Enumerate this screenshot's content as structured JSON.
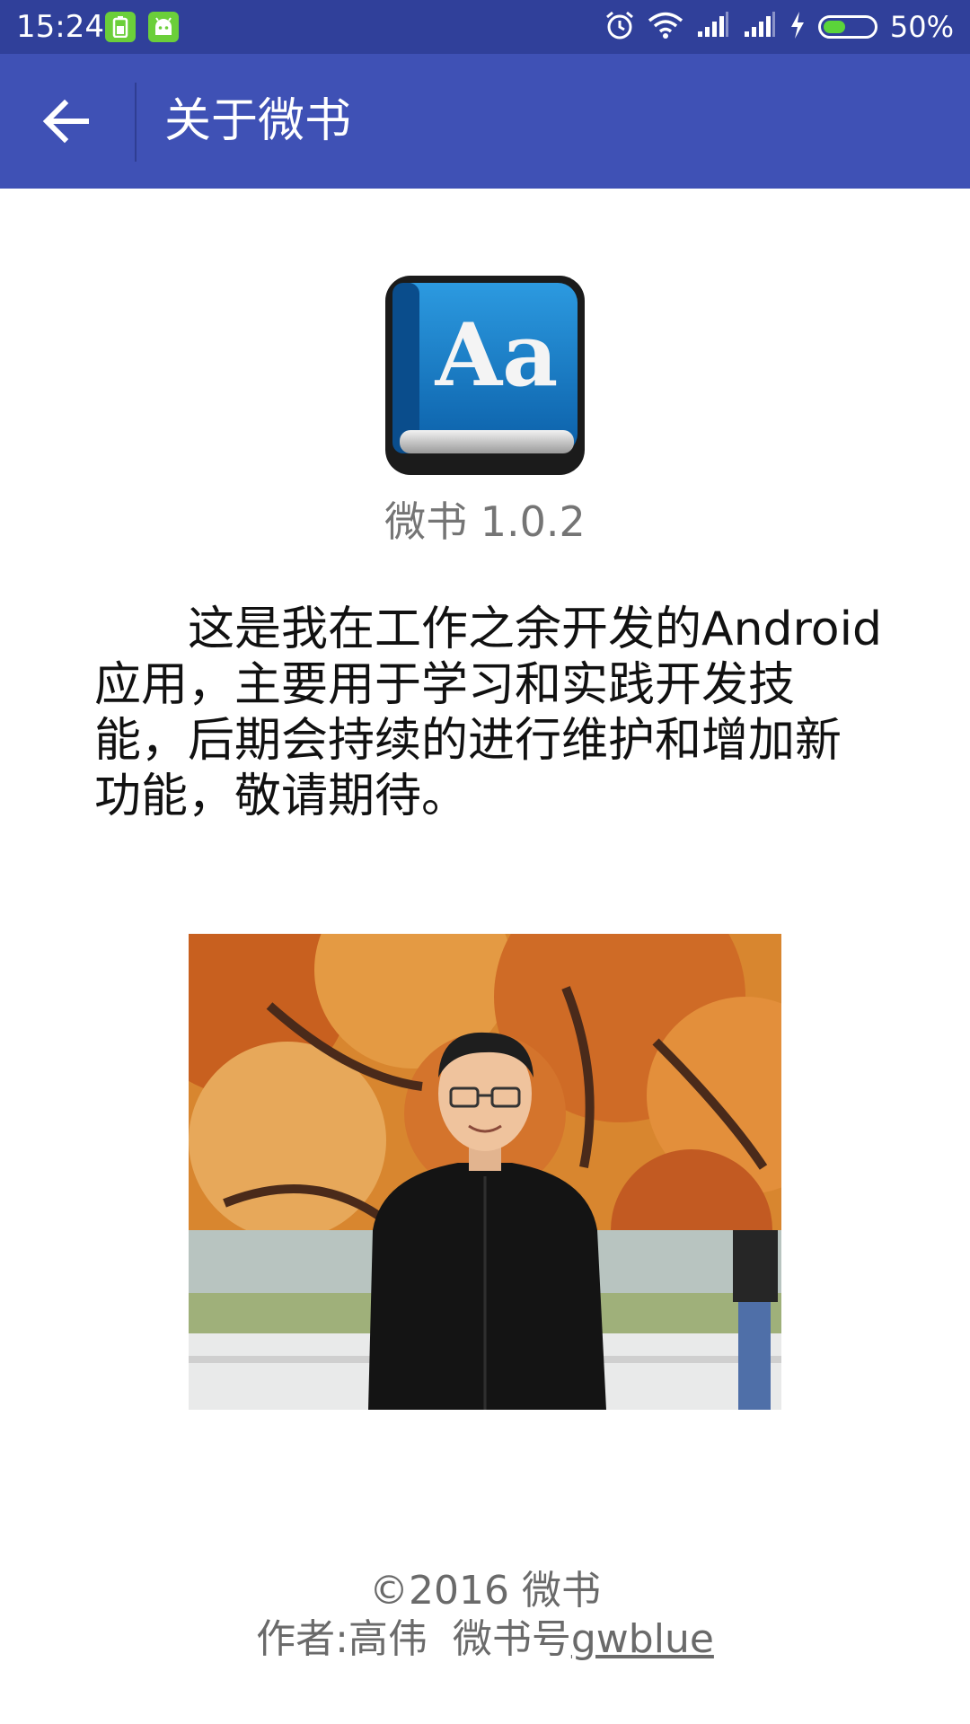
{
  "status_bar": {
    "time": "15:24",
    "battery_percent": "50%",
    "battery_level": 0.5,
    "icons": [
      "battery-saver-icon",
      "android-icon",
      "alarm-icon",
      "wifi-icon",
      "signal-icon",
      "signal-icon",
      "charging-icon",
      "battery-icon"
    ]
  },
  "toolbar": {
    "back_icon": "arrow-left-icon",
    "title": "关于微书"
  },
  "about": {
    "app_icon": "book-icon",
    "app_icon_letters": "Aa",
    "version": "微书 1.0.2",
    "description": "这是我在工作之余开发的Android应用，主要用于学习和实践开发技能，后期会持续的进行维护和增加新功能，敬请期待。",
    "photo": "author-photo"
  },
  "footer": {
    "copyright": "©2016 微书",
    "author_label": "作者:高伟  微书号",
    "author_link": "gwblue"
  },
  "colors": {
    "status_bar": "#30409a",
    "app_bar": "#3f51b5",
    "text_secondary": "#757575"
  }
}
